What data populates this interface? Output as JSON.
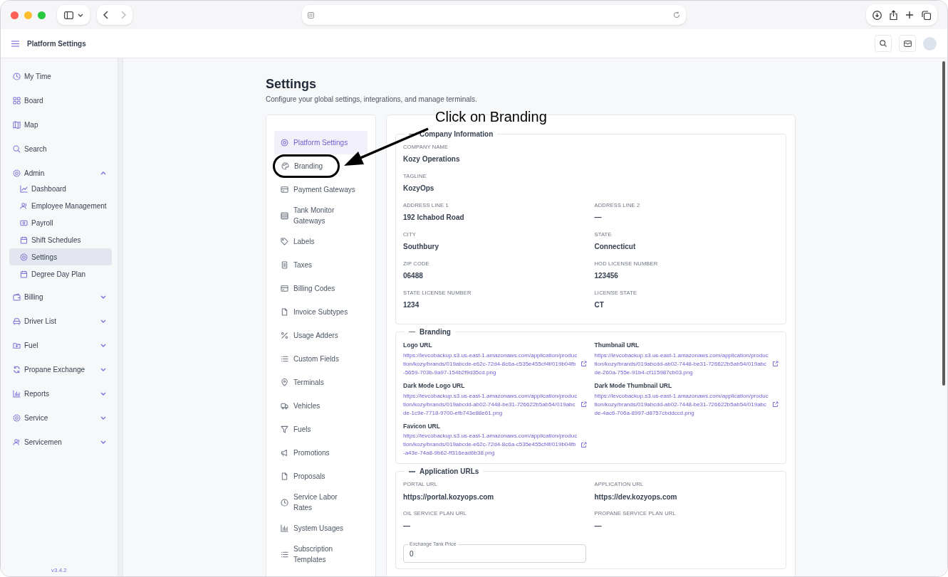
{
  "app_header": {
    "title": "Platform Settings"
  },
  "sidebar": {
    "items": [
      {
        "label": "My Time",
        "selected": false
      },
      {
        "label": "Board",
        "selected": false
      },
      {
        "label": "Map",
        "selected": false
      },
      {
        "label": "Search",
        "selected": false
      },
      {
        "label": "Admin",
        "selected": false,
        "expanded": true,
        "children": [
          {
            "label": "Dashboard",
            "selected": false
          },
          {
            "label": "Employee Management",
            "selected": false
          },
          {
            "label": "Payroll",
            "selected": false
          },
          {
            "label": "Shift Schedules",
            "selected": false
          },
          {
            "label": "Settings",
            "selected": true
          },
          {
            "label": "Degree Day Plan",
            "selected": false
          }
        ]
      },
      {
        "label": "Billing",
        "selected": false,
        "expanded": false
      },
      {
        "label": "Driver List",
        "selected": false,
        "expanded": false
      },
      {
        "label": "Fuel",
        "selected": false,
        "expanded": false
      },
      {
        "label": "Propane Exchange",
        "selected": false,
        "expanded": false
      },
      {
        "label": "Reports",
        "selected": false,
        "expanded": false
      },
      {
        "label": "Service",
        "selected": false,
        "expanded": false
      },
      {
        "label": "Servicemen",
        "selected": false,
        "expanded": false
      }
    ],
    "version": "v3.4.2"
  },
  "page": {
    "title": "Settings",
    "subtitle": "Configure your global settings, integrations, and manage terminals."
  },
  "settings_nav": [
    {
      "label": "Platform Settings",
      "selected": true
    },
    {
      "label": "Branding",
      "selected": false,
      "circled": true
    },
    {
      "label": "Payment Gateways",
      "selected": false
    },
    {
      "label": "Tank Monitor Gateways",
      "selected": false
    },
    {
      "label": "Labels",
      "selected": false
    },
    {
      "label": "Taxes",
      "selected": false
    },
    {
      "label": "Billing Codes",
      "selected": false
    },
    {
      "label": "Invoice Subtypes",
      "selected": false
    },
    {
      "label": "Usage Adders",
      "selected": false
    },
    {
      "label": "Custom Fields",
      "selected": false
    },
    {
      "label": "Terminals",
      "selected": false
    },
    {
      "label": "Vehicles",
      "selected": false
    },
    {
      "label": "Fuels",
      "selected": false
    },
    {
      "label": "Promotions",
      "selected": false
    },
    {
      "label": "Proposals",
      "selected": false
    },
    {
      "label": "Service Labor Rates",
      "selected": false
    },
    {
      "label": "System Usages",
      "selected": false
    },
    {
      "label": "Subscription Templates",
      "selected": false
    }
  ],
  "sections": [
    {
      "kind": "fields",
      "title": "Company Information",
      "rows": [
        [
          {
            "label": "COMPANY NAME",
            "value": "Kozy Operations"
          }
        ],
        [
          {
            "label": "TAGLINE",
            "value": "KozyOps"
          }
        ],
        [
          {
            "label": "ADDRESS LINE 1",
            "value": "192 Ichabod Road"
          },
          {
            "label": "ADDRESS LINE 2",
            "value": "—"
          }
        ],
        [
          {
            "label": "CITY",
            "value": "Southbury"
          },
          {
            "label": "STATE",
            "value": "Connecticut"
          }
        ],
        [
          {
            "label": "ZIP CODE",
            "value": "06488"
          },
          {
            "label": "HOD LICENSE NUMBER",
            "value": "123456"
          }
        ],
        [
          {
            "label": "STATE LICENSE NUMBER",
            "value": "1234"
          },
          {
            "label": "LICENSE STATE",
            "value": "CT"
          }
        ]
      ]
    },
    {
      "kind": "links",
      "title": "Branding",
      "links": [
        {
          "label": "Logo URL",
          "url": "https://levcobackup.s3.us-east-1.amazonaws.com/application/production/kozy/brands/019abcde-e62c-72d4-8c6a-c535e455cf4f/019b04fb-5659-703b-9a97-154b2f9d35cd.png"
        },
        {
          "label": "Thumbnail URL",
          "url": "https://levcobackup.s3.us-east-1.amazonaws.com/application/production/kozy/brands/019abcdd-ab02-7448-be31-726622b5ab54/019abcde-260a-755e-91b4-cf115987cb03.png"
        },
        {
          "label": "Dark Mode Logo URL",
          "url": "https://levcobackup.s3.us-east-1.amazonaws.com/application/production/kozy/brands/019abcdd-ab02-7448-be31-726622b5ab54/019abcde-1c9e-7718-9700-efb743e88e61.png"
        },
        {
          "label": "Dark Mode Thumbnail URL",
          "url": "https://levcobackup.s3.us-east-1.amazonaws.com/application/production/kozy/brands/019abcdd-ab02-7448-be31-726622b5ab54/019abcde-4ac6-706a-8997-d8757cbddccd.png"
        },
        {
          "label": "Favicon URL",
          "url": "https://levcobackup.s3.us-east-1.amazonaws.com/application/production/kozy/brands/019abcde-e62c-72d4-8c6a-c535e455cf4f/019b04fb-a43e-74a8-9b62-ff316ead6b38.png"
        }
      ]
    },
    {
      "kind": "fields",
      "title": "Application URLs",
      "rows": [
        [
          {
            "label": "PORTAL URL",
            "value": "https://portal.kozyops.com"
          },
          {
            "label": "APPLICATION URL",
            "value": "https://dev.kozyops.com"
          }
        ],
        [
          {
            "label": "OIL SERVICE PLAN URL",
            "value": "—"
          },
          {
            "label": "PROPANE SERVICE PLAN URL",
            "value": "—"
          }
        ]
      ],
      "input": {
        "label": "Exchange Tank Price",
        "value": "0"
      }
    }
  ],
  "annotation": {
    "text": "Click on Branding"
  }
}
